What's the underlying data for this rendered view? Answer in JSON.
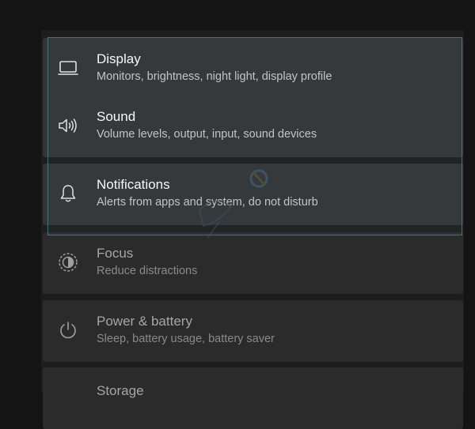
{
  "items": [
    {
      "title": "Display",
      "subtitle": "Monitors, brightness, night light, display profile",
      "icon": "monitor-icon"
    },
    {
      "title": "Sound",
      "subtitle": "Volume levels, output, input, sound devices",
      "icon": "speaker-icon"
    },
    {
      "title": "Notifications",
      "subtitle": "Alerts from apps and system, do not disturb",
      "icon": "bell-icon"
    },
    {
      "title": "Focus",
      "subtitle": "Reduce distractions",
      "icon": "focus-icon"
    },
    {
      "title": "Power & battery",
      "subtitle": "Sleep, battery usage, battery saver",
      "icon": "power-icon"
    },
    {
      "title": "Storage",
      "subtitle": "",
      "icon": "storage-icon"
    }
  ],
  "colors": {
    "background": "#141414",
    "item_background": "#2b2b2b",
    "highlight_background": "#333436",
    "selection_border": "#4a6f7a"
  }
}
